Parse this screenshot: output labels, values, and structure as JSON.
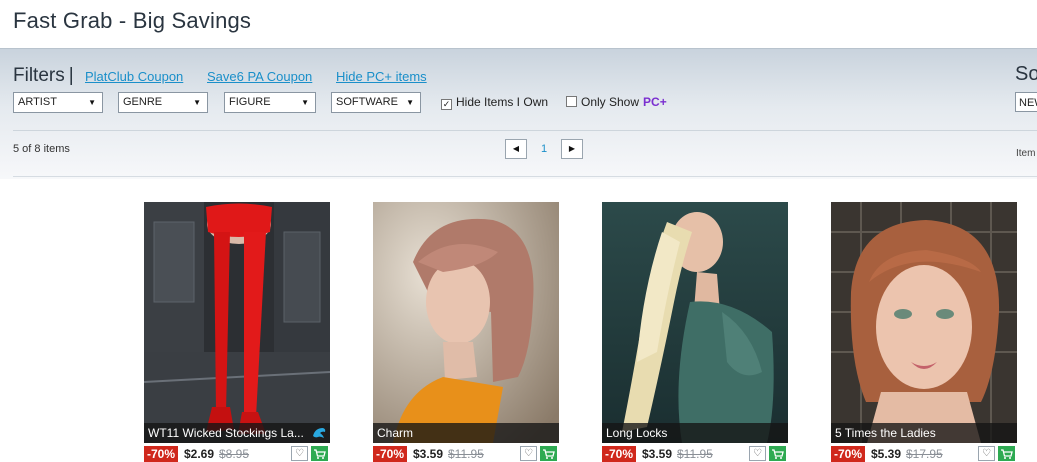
{
  "page_title": "Fast Grab - Big Savings",
  "filters": {
    "heading": "Filters",
    "separator": "|",
    "links": [
      "PlatClub Coupon",
      "Save6 PA Coupon",
      "Hide PC+ items"
    ],
    "dropdowns": [
      "ARTIST",
      "GENRE",
      "FIGURE",
      "SOFTWARE"
    ],
    "hide_owned": {
      "label": "Hide Items I Own",
      "checked": true
    },
    "only_show": {
      "label": "Only Show",
      "badge": "PC+",
      "checked": false
    }
  },
  "sort": {
    "heading": "So",
    "value": "NEW"
  },
  "results": {
    "count_text": "5 of 8 items",
    "page": "1",
    "items_label": "Item"
  },
  "colors": {
    "discount": "#d0281c",
    "cart": "#2eaa52",
    "link": "#1a8fc9",
    "pcplus": "#7b2fd0"
  },
  "products": [
    {
      "name": "WT11 Wicked Stockings La...",
      "discount": "-70%",
      "price": "$2.69",
      "old_price": "$8.95",
      "badge_icon": "dolphin-icon"
    },
    {
      "name": "Charm",
      "discount": "-70%",
      "price": "$3.59",
      "old_price": "$11.95"
    },
    {
      "name": "Long Locks",
      "discount": "-70%",
      "price": "$3.59",
      "old_price": "$11.95"
    },
    {
      "name": "5 Times the Ladies",
      "discount": "-70%",
      "price": "$5.39",
      "old_price": "$17.95"
    }
  ]
}
